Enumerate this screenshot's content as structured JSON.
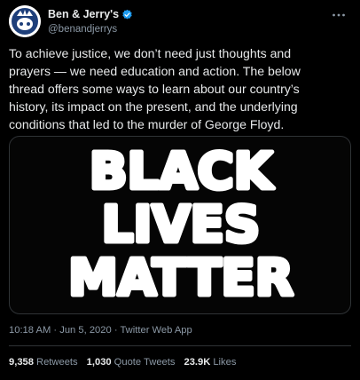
{
  "author": {
    "display_name": "Ben & Jerry's",
    "handle": "@benandjerrys",
    "verified": true
  },
  "tweet": {
    "text_lines": [
      "To achieve justice, we don’t need just thoughts and",
      "prayers — we need education and action. The below",
      "thread offers some ways to learn about our country’s",
      "history, its impact on the present, and the underlying",
      "conditions that led to the murder of George Floyd."
    ],
    "media_words": [
      "BLACK",
      "LIVES",
      "MATTER"
    ],
    "time": "10:18 AM",
    "date": "Jun 5, 2020",
    "source": "Twitter Web App",
    "separator": "·"
  },
  "stats": {
    "retweets": "9,358",
    "retweets_label": "Retweets",
    "quotes": "1,030",
    "quotes_label": "Quote Tweets",
    "likes": "23.9K",
    "likes_label": "Likes"
  },
  "icons": {
    "verified": "verified-badge-icon",
    "more": "more-options-icon"
  },
  "colors": {
    "background": "#000000",
    "text": "#e7e9ea",
    "secondary": "#8b98a5",
    "verified": "#1d9bf0"
  }
}
